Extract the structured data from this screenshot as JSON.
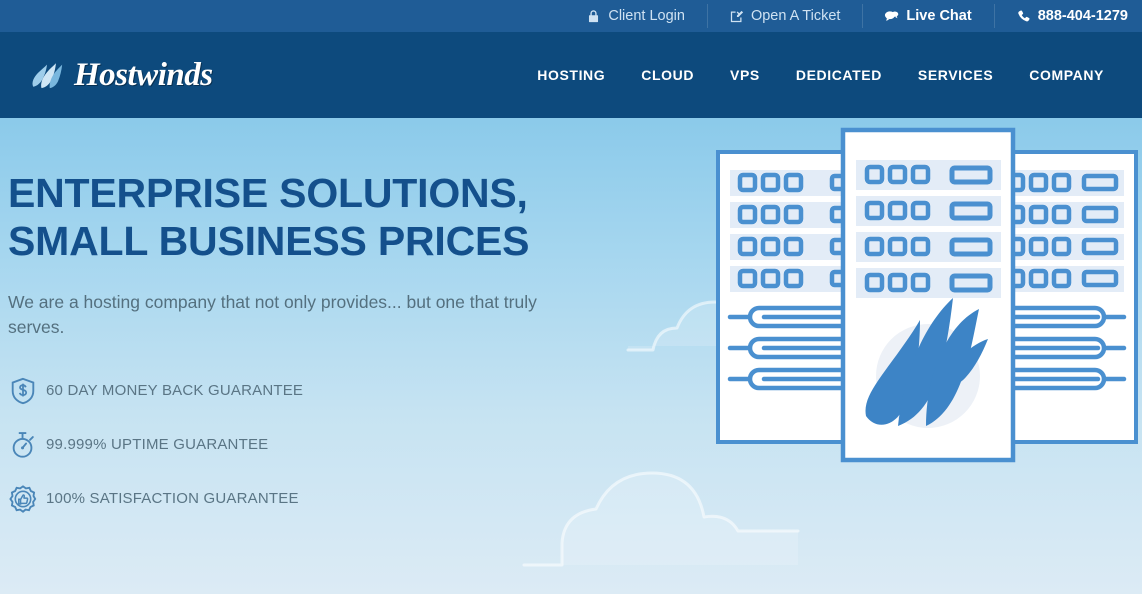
{
  "colors": {
    "topbar_bg": "#1f5c96",
    "header_bg": "#0d4a7d",
    "hero_top": "#8bcaea",
    "hero_bottom": "#dcebf5",
    "headline": "#14508c",
    "body_text": "#54707f",
    "server_blue": "#4a90d0",
    "logo_wave": "#9ecdea"
  },
  "topbar": {
    "links": [
      {
        "label": "Client Login",
        "icon": "lock-icon"
      },
      {
        "label": "Open A Ticket",
        "icon": "edit-square-icon"
      },
      {
        "label": "Live Chat",
        "icon": "chat-bubbles-icon"
      },
      {
        "label": "888-404-1279",
        "icon": "phone-icon"
      }
    ]
  },
  "header": {
    "logo_text": "Hostwinds",
    "logo_icon": "hostwinds-wave-logo",
    "nav": [
      {
        "label": "HOSTING"
      },
      {
        "label": "CLOUD"
      },
      {
        "label": "VPS"
      },
      {
        "label": "DEDICATED"
      },
      {
        "label": "SERVICES"
      },
      {
        "label": "COMPANY"
      }
    ]
  },
  "hero": {
    "title_line1": "ENTERPRISE SOLUTIONS,",
    "title_line2": "SMALL BUSINESS PRICES",
    "subtitle": "We are a hosting company that not only provides... but one that truly serves.",
    "guarantees": [
      {
        "label": "60 DAY MONEY BACK GUARANTEE",
        "icon": "shield-dollar-icon"
      },
      {
        "label": "99.999% UPTIME GUARANTEE",
        "icon": "stopwatch-icon"
      },
      {
        "label": "100% SATISFACTION GUARANTEE",
        "icon": "badge-thumbsup-icon"
      }
    ],
    "illustration": "server-racks-with-hostwinds-logo"
  }
}
